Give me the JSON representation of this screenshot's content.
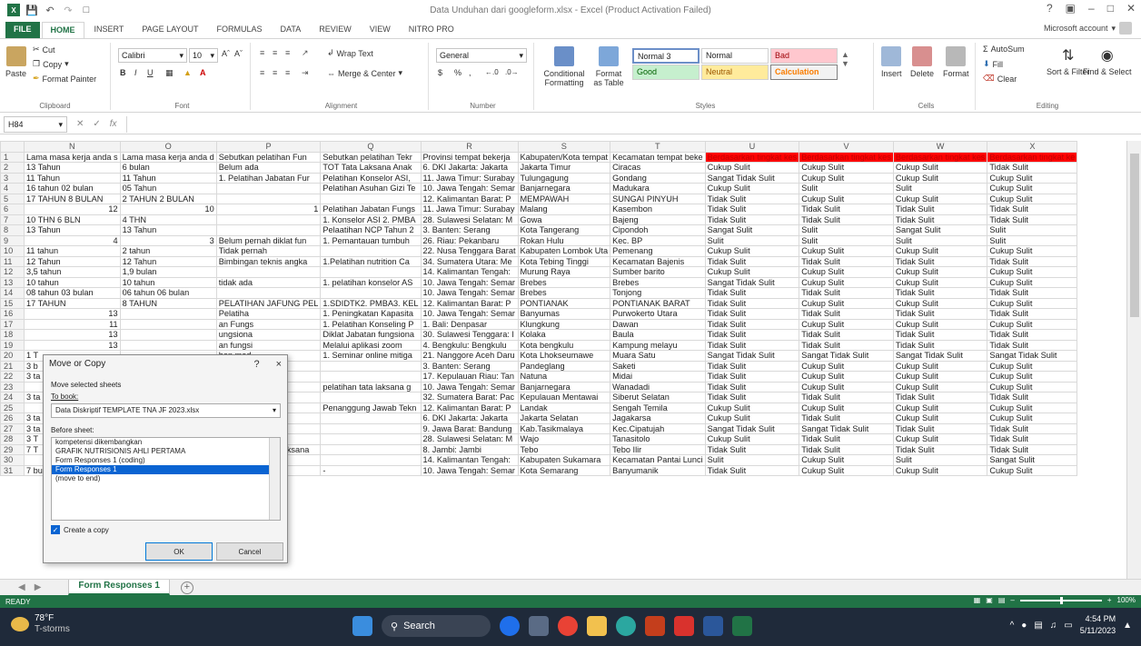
{
  "window": {
    "title": "Data Unduhan dari googleform.xlsx - Excel (Product Activation Failed)",
    "account": "Microsoft account"
  },
  "tabs": [
    "FILE",
    "HOME",
    "INSERT",
    "PAGE LAYOUT",
    "FORMULAS",
    "DATA",
    "REVIEW",
    "VIEW",
    "NITRO PRO"
  ],
  "active_tab": "HOME",
  "ribbon": {
    "clipboard": {
      "label": "Clipboard",
      "paste": "Paste",
      "cut": "Cut",
      "copy": "Copy",
      "format_painter": "Format Painter"
    },
    "font": {
      "label": "Font",
      "name": "Calibri",
      "size": "10",
      "bold": "B",
      "italic": "I",
      "underline": "U"
    },
    "alignment": {
      "label": "Alignment",
      "wrap": "Wrap Text",
      "merge": "Merge & Center"
    },
    "number": {
      "label": "Number",
      "format": "General",
      "currency": "$",
      "percent": "%",
      "comma": ","
    },
    "styles_group": {
      "label": "Styles",
      "conditional": "Conditional Formatting",
      "format_as": "Format as Table",
      "normal3": "Normal 3",
      "normal": "Normal",
      "bad": "Bad",
      "good": "Good",
      "neutral": "Neutral",
      "calculation": "Calculation"
    },
    "cells": {
      "label": "Cells",
      "insert": "Insert",
      "delete": "Delete",
      "format": "Format"
    },
    "editing": {
      "label": "Editing",
      "autosum": "AutoSum",
      "fill": "Fill",
      "clear": "Clear",
      "sort": "Sort & Filter",
      "find": "Find & Select"
    }
  },
  "formula_bar": {
    "name_box": "H84",
    "fx": "fx",
    "value": ""
  },
  "columns": [
    "N",
    "O",
    "P",
    "Q",
    "R",
    "S",
    "T",
    "U",
    "V",
    "W",
    "X"
  ],
  "rows": [
    {
      "n": "1",
      "cells": [
        "Lama masa kerja anda s",
        "Lama masa kerja anda d",
        "Sebutkan pelatihan Fun",
        "Sebutkan pelatihan Tekr",
        "Provinsi tempat bekerja",
        "Kabupaten/Kota tempat",
        "Kecamatan tempat beke",
        "Berdasarkan tingkat kes",
        "Berdasarkan tingkat kes",
        "Berdasarkan tingkat kes",
        "Berdasarkan tingkat ke"
      ]
    },
    {
      "n": "2",
      "cells": [
        "13 Tahun",
        "6 bulan",
        "Belum ada",
        "TOT Tata Laksana Anak",
        "6. DKI Jakarta: Jakarta",
        "Jakarta Timur",
        "Ciracas",
        "Cukup Sulit",
        "Cukup Sulit",
        "Cukup Sulit",
        "Tidak Sulit"
      ]
    },
    {
      "n": "3",
      "cells": [
        "11 Tahun",
        "11 Tahun",
        "1. Pelatihan Jabatan Fur",
        "Pelatihan Konselor ASI,",
        "11. Jawa Timur: Surabay",
        "Tulungagung",
        "Gondang",
        "Sangat Tidak Sulit",
        "Cukup Sulit",
        "Cukup Sulit",
        "Cukup Sulit"
      ]
    },
    {
      "n": "4",
      "cells": [
        "16 tahun 02 bulan",
        "05 Tahun",
        "",
        "Pelatihan Asuhan Gizi Te",
        "10. Jawa Tengah: Semar",
        "Banjarnegara",
        "Madukara",
        "Cukup Sulit",
        "Sulit",
        "Sulit",
        "Cukup Sulit"
      ]
    },
    {
      "n": "5",
      "cells": [
        "17 TAHUN 8 BULAN",
        "2 TAHUN 2 BULAN",
        "",
        "",
        "12. Kalimantan Barat: P",
        "MEMPAWAH",
        "SUNGAI PINYUH",
        "Tidak Sulit",
        "Cukup Sulit",
        "Cukup Sulit",
        "Cukup Sulit"
      ]
    },
    {
      "n": "6",
      "cells": [
        "12",
        "10",
        "1",
        "Pelatihan Jabatan Fungs",
        "11. Jawa Timur: Surabay",
        "Malang",
        "Kasembon",
        "Tidak Sulit",
        "Tidak Sulit",
        "Tidak Sulit",
        "Tidak Sulit"
      ]
    },
    {
      "n": "7",
      "cells": [
        "10 THN 6 BLN",
        "4 THN",
        "",
        "1. Konselor ASI 2. PMBA",
        "28. Sulawesi Selatan: M",
        "Gowa",
        "Bajeng",
        "Tidak Sulit",
        "Tidak Sulit",
        "Tidak Sulit",
        "Tidak Sulit"
      ]
    },
    {
      "n": "8",
      "cells": [
        "13 Tahun",
        "13 Tahun",
        "",
        "Pelaatihan NCP Tahun 2",
        "3. Banten: Serang",
        "Kota Tangerang",
        "Cipondoh",
        "Sangat Sulit",
        "Sulit",
        "Sangat Sulit",
        "Sulit"
      ]
    },
    {
      "n": "9",
      "cells": [
        "4",
        "3",
        "Belum pernah diklat fun",
        "1. Pemantauan tumbuh",
        "26. Riau: Pekanbaru",
        "Rokan Hulu",
        "Kec. BP",
        "Sulit",
        "Sulit",
        "Sulit",
        "Sulit"
      ]
    },
    {
      "n": "10",
      "cells": [
        "11 tahun",
        "2 tahun",
        "Tidak pernah",
        "",
        "22. Nusa Tenggara Barat",
        "Kabupaten Lombok Uta",
        "Pemenang",
        "Cukup Sulit",
        "Cukup Sulit",
        "Cukup Sulit",
        "Cukup Sulit"
      ]
    },
    {
      "n": "11",
      "cells": [
        "12 Tahun",
        "12 Tahun",
        "Bimbingan teknis angka",
        "1.Pelatihan nutrition Ca",
        "34. Sumatera Utara: Me",
        "Kota Tebing Tinggi",
        "Kecamatan Bajenis",
        "Tidak Sulit",
        "Tidak Sulit",
        "Tidak Sulit",
        "Tidak Sulit"
      ]
    },
    {
      "n": "12",
      "cells": [
        "3,5 tahun",
        "1,9 bulan",
        "",
        "",
        "14. Kalimantan Tengah:",
        "Murung Raya",
        "Sumber barito",
        "Cukup Sulit",
        "Cukup Sulit",
        "Cukup Sulit",
        "Cukup Sulit"
      ]
    },
    {
      "n": "13",
      "cells": [
        "10  tahun",
        "10 tahun",
        "tidak ada",
        "1. pelatihan konselor AS",
        "10. Jawa Tengah: Semar",
        "Brebes",
        "Brebes",
        "Sangat Tidak Sulit",
        "Cukup Sulit",
        "Cukup Sulit",
        "Cukup Sulit"
      ]
    },
    {
      "n": "14",
      "cells": [
        "08 tahun 03 bulan",
        "06 tahun 06 bulan",
        "",
        "",
        "10. Jawa Tengah: Semar",
        "Brebes",
        "Tonjong",
        "Tidak Sulit",
        "Tidak Sulit",
        "Tidak Sulit",
        "Tidak Sulit"
      ]
    },
    {
      "n": "15",
      "cells": [
        "17 TAHUN",
        "8 TAHUN",
        "PELATIHAN JAFUNG PEL",
        "1.SDIDTK2. PMBA3. KEL",
        "12. Kalimantan Barat: P",
        "PONTIANAK",
        "PONTIANAK BARAT",
        "Tidak Sulit",
        "Cukup Sulit",
        "Cukup Sulit",
        "Cukup Sulit"
      ]
    },
    {
      "n": "16",
      "cells": [
        "13",
        "",
        "Pelatiha",
        "1. Peningkatan Kapasita",
        "10. Jawa Tengah: Semar",
        "Banyumas",
        "Purwokerto Utara",
        "Tidak Sulit",
        "Tidak Sulit",
        "Tidak Sulit",
        "Tidak Sulit"
      ]
    },
    {
      "n": "17",
      "cells": [
        "11",
        "",
        "an Fungs",
        "1. Pelatihan Konseling P",
        "1. Bali: Denpasar",
        "Klungkung",
        "Dawan",
        "Tidak Sulit",
        "Cukup Sulit",
        "Cukup Sulit",
        "Cukup Sulit"
      ]
    },
    {
      "n": "18",
      "cells": [
        "13",
        "",
        "ungsiona",
        "Diklat Jabatan fungsiona",
        "30. Sulawesi Tenggara: I",
        "Kolaka",
        "Baula",
        "Tidak Sulit",
        "Tidak Sulit",
        "Tidak Sulit",
        "Tidak Sulit"
      ]
    },
    {
      "n": "19",
      "cells": [
        "13",
        "",
        "an fungsi",
        "Melalui aplikasi zoom",
        "4. Bengkulu: Bengkulu",
        "Kota bengkulu",
        "Kampung melayu",
        "Tidak Sulit",
        "Tidak Sulit",
        "Tidak Sulit",
        "Tidak Sulit"
      ]
    },
    {
      "n": "20",
      "cells": [
        "1 T",
        "",
        "han med",
        "1. Seminar online mitiga",
        "21. Nanggore Aceh Daru",
        "Kota Lhokseumawe",
        "Muara Satu",
        "Sangat Tidak Sulit",
        "Sangat Tidak Sulit",
        "Sangat Tidak Sulit",
        "Sangat Tidak Sulit"
      ]
    },
    {
      "n": "21",
      "cells": [
        "3 b",
        "",
        "netri kit",
        "",
        "3. Banten: Serang",
        "Pandeglang",
        "Saketi",
        "Tidak Sulit",
        "Cukup Sulit",
        "Cukup Sulit",
        "Cukup Sulit"
      ]
    },
    {
      "n": "22",
      "cells": [
        "3 ta",
        "",
        "",
        "",
        "17. Kepulauan Riau: Tan",
        "Natuna",
        "Midai",
        "Tidak Sulit",
        "Cukup Sulit",
        "Cukup Sulit",
        "Cukup Sulit"
      ]
    },
    {
      "n": "23",
      "cells": [
        "22",
        "",
        "",
        "pelatihan  tata laksana g",
        "10. Jawa Tengah: Semar",
        "Banjarnegara",
        "Wanadadi",
        "Tidak Sulit",
        "Cukup Sulit",
        "Cukup Sulit",
        "Cukup Sulit"
      ]
    },
    {
      "n": "24",
      "cells": [
        "3 ta",
        "",
        "",
        "",
        "32. Sumatera Barat: Pac",
        "Kepulauan Mentawai",
        "Siberut Selatan",
        "Tidak Sulit",
        "Tidak Sulit",
        "Tidak Sulit",
        "Tidak Sulit"
      ]
    },
    {
      "n": "25",
      "cells": [
        "",
        "",
        "gi Tenaga",
        "Penanggung Jawab Tekn",
        "12. Kalimantan Barat: P",
        "Landak",
        "Sengah Temila",
        "Cukup Sulit",
        "Cukup Sulit",
        "Cukup Sulit",
        "Cukup Sulit"
      ]
    },
    {
      "n": "26",
      "cells": [
        "3 ta",
        "",
        "Belum ada",
        "",
        "6. DKI Jakarta: Jakarta",
        "Jakarta Selatan",
        "Jagakarsa",
        "Cukup Sulit",
        "Tidak Sulit",
        "Cukup Sulit",
        "Cukup Sulit"
      ]
    },
    {
      "n": "27",
      "cells": [
        "3 ta",
        "",
        "",
        "",
        "9. Jawa Barat: Bandung",
        "Kab.Tasikmalaya",
        "Kec.Cipatujah",
        "Sangat Tidak Sulit",
        "Sangat Tidak Sulit",
        "Tidak Sulit",
        "Tidak Sulit"
      ]
    },
    {
      "n": "28",
      "cells": [
        "3 T",
        "",
        "NCP dan PMBA",
        "",
        "28. Sulawesi Selatan: M",
        "Wajo",
        "Tanasitolo",
        "Cukup Sulit",
        "Tidak Sulit",
        "Cukup Sulit",
        "Tidak Sulit"
      ]
    },
    {
      "n": "29",
      "cells": [
        "7 T",
        "",
        "1. pelatihan tata laksana",
        "",
        "8. Jambi: Jambi",
        "Tebo",
        "Tebo Ilir",
        "Tidak Sulit",
        "Tidak Sulit",
        "Tidak Sulit",
        "Tidak Sulit"
      ]
    },
    {
      "n": "30",
      "cells": [
        "01",
        "",
        "Tidak Ada",
        "",
        "14. Kalimantan Tengah:",
        "Kabupaten Sukamara",
        "Kecamatan Pantai Lunci",
        "Sulit",
        "Cukup Sulit",
        "Sulit",
        "Sangat Sulit"
      ]
    },
    {
      "n": "31",
      "cells": [
        "7 bulan",
        "7 bulan",
        "-",
        "-",
        "10. Jawa Tengah: Semar",
        "Kota Semarang",
        "Banyumanik",
        "Tidak Sulit",
        "Cukup Sulit",
        "Cukup Sulit",
        "Cukup Sulit"
      ]
    }
  ],
  "sheet_tab": "Form Responses 1",
  "status": {
    "ready": "READY",
    "zoom": "100%"
  },
  "dialog": {
    "title": "Move or Copy",
    "help": "?",
    "close": "×",
    "move_label": "Move selected sheets",
    "to_book_label": "To book:",
    "to_book_value": "Data Diskriptif TEMPLATE TNA JF 2023.xlsx",
    "before_label": "Before sheet:",
    "sheets": [
      "kompetensi dikembangkan",
      "GRAFIK NUTRISIONIS AHLI PERTAMA",
      "Form Responses 1 (coding)",
      "Form Responses 1",
      "(move to end)"
    ],
    "selected_index": 3,
    "create_copy": "Create a copy",
    "ok": "OK",
    "cancel": "Cancel"
  },
  "taskbar": {
    "temp": "78°F",
    "weather": "T-storms",
    "search": "Search",
    "time": "4:54 PM",
    "date": "5/11/2023"
  }
}
